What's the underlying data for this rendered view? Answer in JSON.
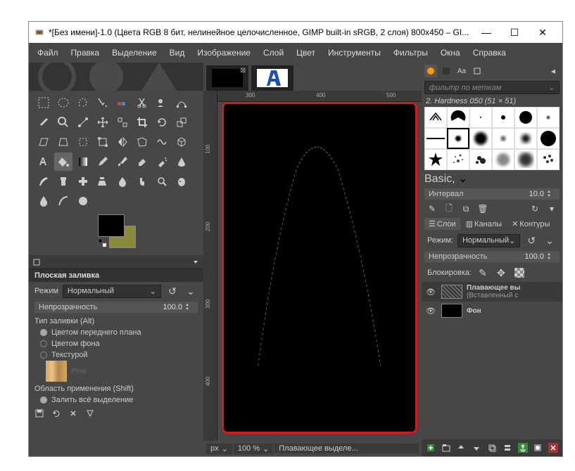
{
  "window": {
    "title": "*[Без имени]-1.0 (Цвета RGB 8 бит, нелинейное целочисленное, GIMP built-in sRGB, 2 слоя) 800x450 – GI..."
  },
  "menubar": [
    "Файл",
    "Правка",
    "Выделение",
    "Вид",
    "Изображение",
    "Слой",
    "Цвет",
    "Инструменты",
    "Фильтры",
    "Окна",
    "Справка"
  ],
  "toolopts": {
    "title": "Плоская заливка",
    "mode_label": "Режим",
    "mode_value": "Нормальный",
    "opacity_label": "Непрозрачность",
    "opacity_value": "100.0",
    "fill_type_label": "Тип заливки (Alt)",
    "fill_fg": "Цветом переднего плана",
    "fill_bg": "Цветом фона",
    "fill_tx": "Текстурой",
    "tx_name": "Pine",
    "area_label": "Область применения (Shift)",
    "area_fill_sel": "Залить всё выделение"
  },
  "status": {
    "unit": "px",
    "zoom": "100 %",
    "msg": "Плавающее выделе..."
  },
  "brushes": {
    "filter_placeholder": "фильтр по меткам",
    "name": "2. Hardness 050 (51 × 51)",
    "tag": "Basic,",
    "interval_label": "Интервал",
    "interval_value": "10.0"
  },
  "ruler": {
    "h": [
      "300",
      "400",
      "500"
    ],
    "v": [
      "100",
      "200",
      "300",
      "400"
    ]
  },
  "layertabs": {
    "layers": "Слои",
    "channels": "Каналы",
    "paths": "Контуры"
  },
  "layers": {
    "mode_label": "Режим:",
    "mode_value": "Нормальный",
    "opacity_label": "Непрозрачность",
    "opacity_value": "100.0",
    "lock_label": "Блокировка:",
    "items": [
      {
        "name": "Плавающее вы",
        "sub": "(Вставленный с"
      },
      {
        "name": "Фон",
        "sub": ""
      }
    ]
  }
}
